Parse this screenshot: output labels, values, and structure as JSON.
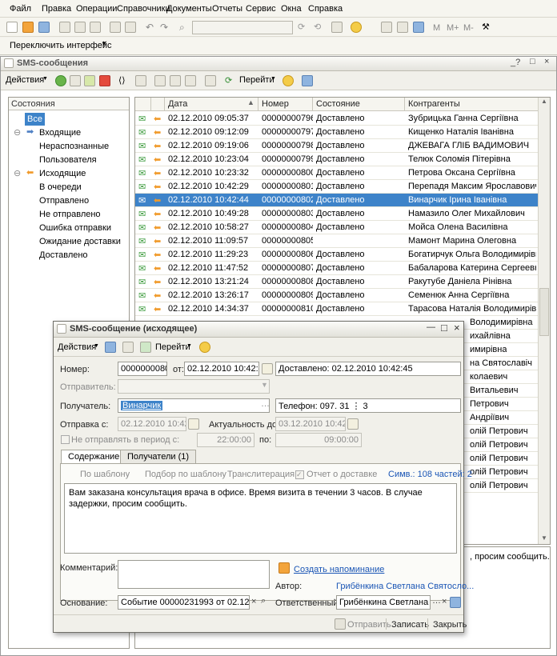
{
  "menu": [
    "Файл",
    "Правка",
    "Операции",
    "Справочники",
    "Документы",
    "Отчеты",
    "Сервис",
    "Окна",
    "Справка"
  ],
  "toolbar": {
    "m_label": "M",
    "mplus_label": "M+",
    "mminus_label": "M-"
  },
  "interface_switch": "Переключить интерфейс",
  "window": {
    "title": "SMS-сообщения",
    "actions_label": "Действия",
    "goto_label": "Перейти"
  },
  "states": {
    "header": "Состояния",
    "items": [
      "Все",
      "Входящие",
      "Нераспознанные",
      "Пользователя",
      "Исходящие",
      "В очереди",
      "Отправлено",
      "Не отправлено",
      "Ошибка отправки",
      "Ожидание доставки",
      "Доставлено"
    ]
  },
  "grid": {
    "columns": [
      "Дата",
      "Номер",
      "Состояние",
      "Контрагенты"
    ],
    "rows": [
      {
        "date": "02.12.2010 09:05:37",
        "num": "00000000796",
        "state": "Доставлено",
        "who": "Зубрицька Ганна Сергіївна"
      },
      {
        "date": "02.12.2010 09:12:09",
        "num": "00000000797",
        "state": "Доставлено",
        "who": "Кищенко Наталія Іванівна"
      },
      {
        "date": "02.12.2010 09:19:06",
        "num": "00000000798",
        "state": "Доставлено",
        "who": "ДЖЕВАГА ГЛІБ ВАДИМОВИЧ"
      },
      {
        "date": "02.12.2010 10:23:04",
        "num": "00000000799",
        "state": "Доставлено",
        "who": "Телюк Соломія Пітерівна"
      },
      {
        "date": "02.12.2010 10:23:32",
        "num": "00000000800",
        "state": "Доставлено",
        "who": "Петрова Оксана Сергіївна"
      },
      {
        "date": "02.12.2010 10:42:29",
        "num": "00000000801",
        "state": "Доставлено",
        "who": "Перепадя  Максим Ярославович"
      },
      {
        "date": "02.12.2010 10:42:44",
        "num": "00000000802",
        "state": "Доставлено",
        "who": "Винарчик Ірина Іванівна"
      },
      {
        "date": "02.12.2010 10:49:28",
        "num": "00000000803",
        "state": "Доставлено",
        "who": "Намазило Олег Михайлович"
      },
      {
        "date": "02.12.2010 10:58:27",
        "num": "00000000804",
        "state": "Доставлено",
        "who": "Мойса Олена Василівна"
      },
      {
        "date": "02.12.2010 11:09:57",
        "num": "00000000805",
        "state": "",
        "who": "Мамонт Марина Олеговна"
      },
      {
        "date": "02.12.2010 11:29:23",
        "num": "00000000806",
        "state": "Доставлено",
        "who": "Богатирчук Ольга Володимирівна"
      },
      {
        "date": "02.12.2010 11:47:52",
        "num": "00000000807",
        "state": "Доставлено",
        "who": "Бабаларова Катерина Сергеевна"
      },
      {
        "date": "02.12.2010 13:21:24",
        "num": "00000000808",
        "state": "Доставлено",
        "who": "Ракутубе Даніела Рінівна"
      },
      {
        "date": "02.12.2010 13:26:17",
        "num": "00000000809",
        "state": "Доставлено",
        "who": "Семенюк Анна Сергіївна"
      },
      {
        "date": "02.12.2010 14:34:37",
        "num": "00000000810",
        "state": "Доставлено",
        "who": "Тарасова Наталія Володимирівна"
      }
    ],
    "partial_right": [
      "Володимирівна",
      "ихайлівна",
      "имирівна",
      "на Святославіч",
      "колаевич",
      "Витальевич",
      "Петрович",
      "Андріївич",
      "олій Петрович",
      "олій Петрович",
      "олій Петрович",
      "олій Петрович",
      "олій Петрович"
    ]
  },
  "bottom_text": ", просим сообщить.",
  "dialog": {
    "title": "SMS-сообщение (исходящее)",
    "actions_label": "Действия",
    "goto_label": "Перейти",
    "number_label": "Номер:",
    "number_value": "00000000802",
    "from_label": "от:",
    "from_value": "02.12.2010 10:42:44",
    "status_value": "Доставлено: 02.12.2010 10:42:45",
    "sender_label": "Отправитель:",
    "recipient_label": "Получатель:",
    "recipient_value": "Винарчик",
    "phone_value": "Телефон: 097. 31  ⋮ 3",
    "send_label": "Отправка с:",
    "send_value": "02.12.2010 10:42:21",
    "actual_label": "Актуальность до:",
    "actual_value": "03.12.2010 10:42:21",
    "nosend_label": "Не отправлять в период с:",
    "nosend_from": "22:00:00",
    "nosend_to_label": "по:",
    "nosend_to": "09:00:00",
    "tabs": [
      "Содержание",
      "Получатели (1)"
    ],
    "by_template": "По шаблону",
    "pick_template": "Подбор по шаблону",
    "transliterate": "Транслитерация",
    "delivery_report": "Отчет о доставке",
    "symbols": "Симв.: 108 частей: 2",
    "message": "Вам заказана консультация врача в офисе. Время визита в течении 3 часов. В случае задержки, просим сообщить.",
    "comment_label": "Комментарий:",
    "reminder_link": "Создать напоминание",
    "author_label": "Автор:",
    "author_value": "Грибёнкина Светлана Святосло...",
    "basis_label": "Основание:",
    "basis_value": "Событие 00000231993 от 02.12.201",
    "responsible_label": "Ответственный:",
    "responsible_value": "Грибёнкина Светлана С",
    "send_button": "Отправить",
    "save_button": "Записать",
    "close_button": "Закрыть"
  }
}
